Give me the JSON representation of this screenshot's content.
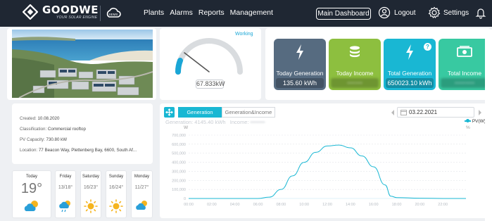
{
  "brand": {
    "name": "GOODWE",
    "tagline": "YOUR SOLAR ENGINE",
    "portal": "SEMS"
  },
  "nav": {
    "items": [
      "Plants",
      "Alarms",
      "Reports",
      "Management"
    ]
  },
  "header": {
    "dashboard_button": "Main Dashboard",
    "logout": "Logout",
    "settings": "Settings"
  },
  "gauge": {
    "status": "Working",
    "value": "67.833kW",
    "fraction": 0.1
  },
  "kpis": [
    {
      "label": "Today Generation",
      "value": "135.60 kWh",
      "color": "#566b80",
      "icon": "lightning-icon",
      "hidden": false
    },
    {
      "label": "Today Income",
      "value": "•••••••",
      "color": "#8dbf3f",
      "icon": "coins-icon",
      "hidden": true
    },
    {
      "label": "Total Generation",
      "value": "650023.10 kWh",
      "color": "#19b7d3",
      "icon": "lightning-icon",
      "hidden": false
    },
    {
      "label": "Total Income",
      "value": "•••••••••",
      "color": "#38c9a1",
      "icon": "banknote-icon",
      "hidden": true
    }
  ],
  "plant_info": {
    "created": {
      "k": "Created:",
      "v": "10.08.2020"
    },
    "classification": {
      "k": "Classification:",
      "v": "Commercial rooftop"
    },
    "capacity": {
      "k": "PV Capacity:",
      "v": "730.80 kW"
    },
    "location": {
      "k": "Location:",
      "v": "77 Beacon Way, Plettenberg Bay, 6600, South Af..."
    }
  },
  "weather": [
    {
      "day": "Today",
      "temp": "19°",
      "icon": "cloud-sun-icon"
    },
    {
      "day": "Friday",
      "temp": "13/18°",
      "icon": "sun-cloud-rain-icon"
    },
    {
      "day": "Saturday",
      "temp": "16/23°",
      "icon": "sun-icon"
    },
    {
      "day": "Sunday",
      "temp": "16/24°",
      "icon": "sun-icon"
    },
    {
      "day": "Monday",
      "temp": "11/27°",
      "icon": "cloud-sun-icon"
    }
  ],
  "chart_panel": {
    "tabs": [
      "Generation",
      "Generation&Income"
    ],
    "generation_label": "Generation:",
    "generation_value": "4145.40 kWh",
    "income_label": "Income:",
    "income_value": "••••••••",
    "date": "03.22.2021",
    "left_unit": "W",
    "right_unit": "%"
  },
  "colors": {
    "accent": "#19b7d3",
    "topbar": "#1f2733",
    "background": "#eef0f3"
  },
  "chart_data": {
    "type": "line",
    "title": "",
    "xlabel": "",
    "ylabel": "W",
    "y2label": "%",
    "ylim": [
      0,
      700000
    ],
    "xlim": [
      0,
      24
    ],
    "yticks": [
      "0",
      "100,000",
      "200,000",
      "300,000",
      "400,000",
      "500,000",
      "600,000",
      "700,000"
    ],
    "xticks": [
      "00:00",
      "02:00",
      "04:00",
      "06:00",
      "08:00",
      "10:00",
      "12:00",
      "14:00",
      "16:00",
      "18:00",
      "20:00",
      "22:00"
    ],
    "legend_position": "top-right",
    "series": [
      {
        "name": "PV(W)",
        "color": "#19b7d3",
        "x": [
          0,
          2,
          4,
          6,
          7,
          8,
          9,
          10,
          11,
          12,
          13,
          14,
          15,
          16,
          17,
          17.5,
          18,
          20,
          22,
          24
        ],
        "y": [
          0,
          0,
          0,
          0,
          15000,
          100000,
          250000,
          400000,
          510000,
          580000,
          590000,
          560000,
          470000,
          350000,
          150000,
          25000,
          10000,
          3000,
          0,
          0
        ]
      }
    ]
  }
}
